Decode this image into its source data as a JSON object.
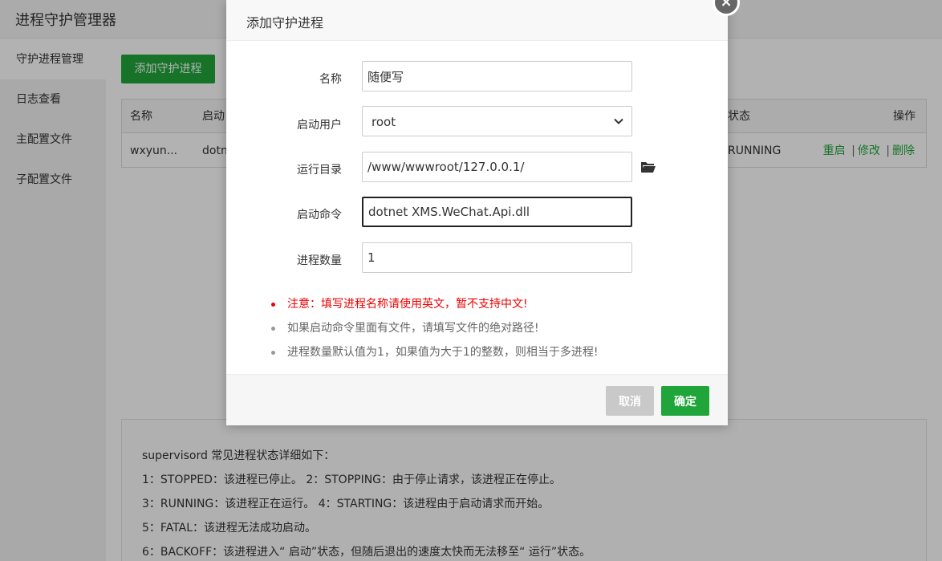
{
  "app": {
    "title": "进程守护管理器"
  },
  "sidebar": {
    "items": [
      {
        "label": "守护进程管理"
      },
      {
        "label": "日志查看"
      },
      {
        "label": "主配置文件"
      },
      {
        "label": "子配置文件"
      }
    ]
  },
  "main": {
    "add_button": "添加守护进程",
    "table": {
      "headers": {
        "name": "名称",
        "start": "启动",
        "status": "状态",
        "ops": "操作"
      },
      "rows": [
        {
          "name": "wxyun...",
          "start": "dotn",
          "status": "RUNNING",
          "restart": "重启",
          "edit": "修改",
          "delete": "删除"
        }
      ],
      "separator": "|"
    },
    "status_info": {
      "intro": "supervisord 常见进程状态详细如下：",
      "lines": [
        "1：STOPPED：该进程已停止。      2：STOPPING：由于停止请求，该进程正在停止。",
        "3：RUNNING：该进程正在运行。 4：STARTING：该进程由于启动请求而开始。",
        "5：FATAL：该进程无法成功启动。",
        "6：BACKOFF：该进程进入“ 启动”状态，但随后退出的速度太快而无法移至“ 运行”状态。"
      ]
    }
  },
  "dialog": {
    "title": "添加守护进程",
    "close_glyph": "×",
    "fields": {
      "name": {
        "label": "名称",
        "value": "随便写"
      },
      "user": {
        "label": "启动用户",
        "value": "root"
      },
      "dir": {
        "label": "运行目录",
        "value": "/www/wwwroot/127.0.0.1/"
      },
      "command": {
        "label": "启动命令",
        "value": "dotnet XMS.WeChat.Api.dll"
      },
      "count": {
        "label": "进程数量",
        "value": "1"
      }
    },
    "tips": [
      "注意：填写进程名称请使用英文，暂不支持中文!",
      "如果启动命令里面有文件，请填写文件的绝对路径!",
      "进程数量默认值为1，如果值为大于1的整数，则相当于多进程!"
    ],
    "buttons": {
      "cancel": "取消",
      "ok": "确定"
    }
  },
  "colors": {
    "brand_green": "#20a53a",
    "warning_red": "#e00000",
    "overlay": "rgba(0,0,0,0.30)"
  },
  "icons": {
    "close": "close-icon",
    "select": "chevron-down-icon",
    "folder": "folder-open-icon"
  }
}
